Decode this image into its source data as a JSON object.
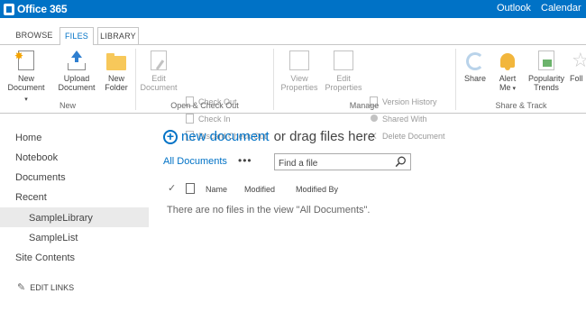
{
  "suite": {
    "brand": "Office 365",
    "links": [
      "Outlook",
      "Calendar"
    ]
  },
  "ribbon": {
    "tabs": [
      "BROWSE",
      "FILES",
      "LIBRARY"
    ],
    "active_tab": "FILES",
    "groups": {
      "new": {
        "label": "New",
        "new_document": [
          "New",
          "Document"
        ],
        "upload_document": [
          "Upload",
          "Document"
        ],
        "new_folder": [
          "New",
          "Folder"
        ]
      },
      "open_checkout": {
        "label": "Open & Check Out",
        "edit_document": [
          "Edit",
          "Document"
        ],
        "check_out": "Check Out",
        "check_in": "Check In",
        "discard_check_out": "Discard Check Out"
      },
      "manage": {
        "label": "Manage",
        "view_properties": [
          "View",
          "Properties"
        ],
        "edit_properties": [
          "Edit",
          "Properties"
        ],
        "version_history": "Version History",
        "shared_with": "Shared With",
        "delete_document": "Delete Document"
      },
      "share_track": {
        "label": "Share & Track",
        "share": "Share",
        "alert_me": [
          "Alert",
          "Me"
        ],
        "popularity_trends": [
          "Popularity",
          "Trends"
        ],
        "follow": "Foll"
      }
    }
  },
  "nav": {
    "items": [
      "Home",
      "Notebook",
      "Documents",
      "Recent"
    ],
    "recent_items": [
      "SampleLibrary",
      "SampleList"
    ],
    "selected": "SampleLibrary",
    "site_contents": "Site Contents",
    "edit_links": "EDIT LINKS"
  },
  "main": {
    "new_document_link": "new document",
    "new_document_rest": "or drag files here",
    "view_name": "All Documents",
    "ellipsis": "•••",
    "search_placeholder": "Find a file",
    "columns": [
      "Name",
      "Modified",
      "Modified By"
    ],
    "empty_message": "There are no files in the view \"All Documents\"."
  },
  "colors": {
    "suite_bar": "#0072c6",
    "link": "#0072c6"
  }
}
